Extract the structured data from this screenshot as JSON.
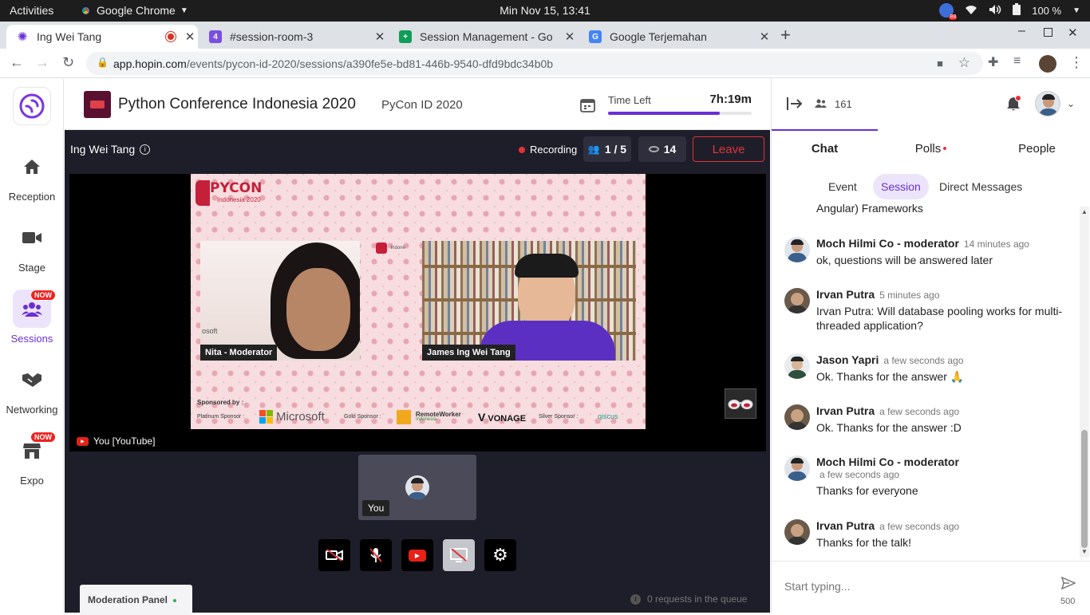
{
  "system": {
    "activities": "Activities",
    "app": "Google Chrome",
    "clock": "Min Nov 15, 13:41",
    "battery": "100 %"
  },
  "browser": {
    "tabs": [
      {
        "title": "Ing Wei Tang"
      },
      {
        "title": "#session-room-3"
      },
      {
        "title": "Session Management - Go"
      },
      {
        "title": "Google Terjemahan"
      }
    ],
    "url_domain": "app.hopin.com",
    "url_path": "/events/pycon-id-2020/sessions/a390fe5e-bd81-446b-9540-dfd9bdc34b0b"
  },
  "nav": {
    "items": [
      {
        "label": "Reception",
        "icon": "home-icon"
      },
      {
        "label": "Stage",
        "icon": "camera-icon"
      },
      {
        "label": "Sessions",
        "icon": "people-icon",
        "badge": "NOW"
      },
      {
        "label": "Networking",
        "icon": "handshake-icon"
      },
      {
        "label": "Expo",
        "icon": "booth-icon",
        "badge": "NOW"
      }
    ]
  },
  "event": {
    "title": "Python Conference Indonesia 2020",
    "subtitle": "PyCon ID 2020",
    "time_left_label": "Time Left",
    "time_left_value": "7h:19m",
    "time_progress": 0.78
  },
  "session": {
    "host": "Ing Wei Tang",
    "recording": "Recording",
    "participants": "1 / 5",
    "viewers": "14",
    "leave": "Leave",
    "stream_label": "You [YouTube]",
    "self_label": "You",
    "moderation_panel": "Moderation Panel",
    "queue_text": "0 requests in the queue"
  },
  "slide": {
    "logo_text": "PYCON",
    "logo_sub": "Indonesia 2020",
    "speaker1": "Nita - Moderator",
    "speaker2": "James Ing Wei Tang",
    "sponsored_by": "Sponsored by :",
    "platinum": "Platinum Sponsor :",
    "microsoft": "Microsoft",
    "gold": "Gold Sponsor :",
    "remoteworker": "RemoteWorker",
    "remoteworker_sub": "Indonesia",
    "vonage": "VONAGE",
    "silver": "Silver Sponsor :",
    "qiscus": "qiscus",
    "small_text_left": "osoft",
    "small_text_right": "Indone"
  },
  "right_panel": {
    "attendees": "161",
    "tabs": [
      "Chat",
      "Polls",
      "People"
    ],
    "subtabs": [
      "Event",
      "Session",
      "Direct Messages"
    ],
    "partial_message": "Angular) Frameworks",
    "messages": [
      {
        "name": "Moch Hilmi Co - moderator",
        "time": "14 minutes ago",
        "text": "ok, questions will be answered later"
      },
      {
        "name": "Irvan Putra",
        "time": "5 minutes ago",
        "text": "Irvan Putra: Will database pooling works for multi-threaded application?"
      },
      {
        "name": "Jason Yapri",
        "time": "a few seconds ago",
        "text": "Ok. Thanks for the answer 🙏"
      },
      {
        "name": "Irvan Putra",
        "time": "a few seconds ago",
        "text": "Ok. Thanks for the answer :D"
      },
      {
        "name": "Moch Hilmi Co - moderator",
        "time": "a few seconds ago",
        "text": "Thanks for everyone"
      },
      {
        "name": "Irvan Putra",
        "time": "a few seconds ago",
        "text": "Thanks for the talk!"
      }
    ],
    "input_placeholder": "Start typing...",
    "char_count": "500"
  },
  "colors": {
    "accent": "#6a2fd6",
    "leave": "#e0323b",
    "recording": "#e0323b"
  }
}
